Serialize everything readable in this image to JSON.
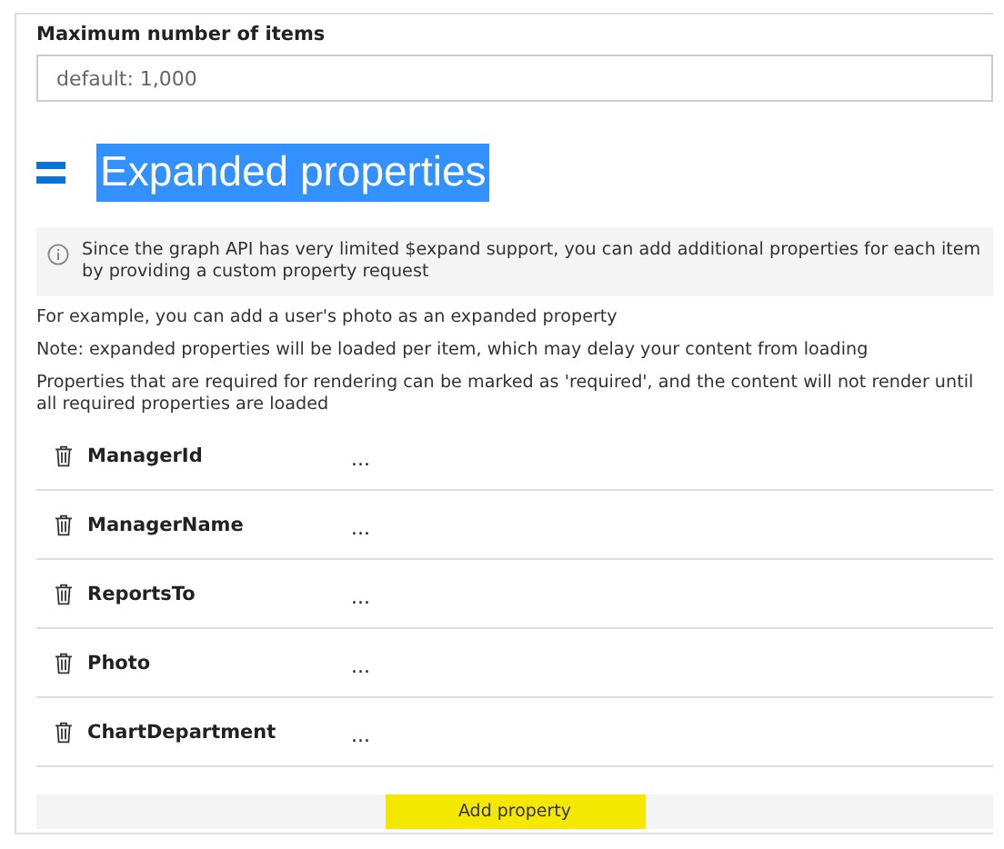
{
  "max_items": {
    "label": "Maximum number of items",
    "placeholder": "default: 1,000"
  },
  "section": {
    "title": "Expanded properties",
    "highlighted": true
  },
  "info": "Since the graph API has very limited $expand support, you can add additional properties for each item by providing a custom property request",
  "notes": [
    "For example, you can add a user's photo as an expanded property",
    "Note: expanded properties will be loaded per item, which may delay your content from loading",
    "Properties that are required for rendering can be marked as 'required', and the content will not render until all required properties are loaded"
  ],
  "properties": [
    {
      "name": "ManagerId",
      "menu": "..."
    },
    {
      "name": "ManagerName",
      "menu": "..."
    },
    {
      "name": "ReportsTo",
      "menu": "..."
    },
    {
      "name": "Photo",
      "menu": "..."
    },
    {
      "name": "ChartDepartment",
      "menu": "..."
    }
  ],
  "add_button": "Add property"
}
